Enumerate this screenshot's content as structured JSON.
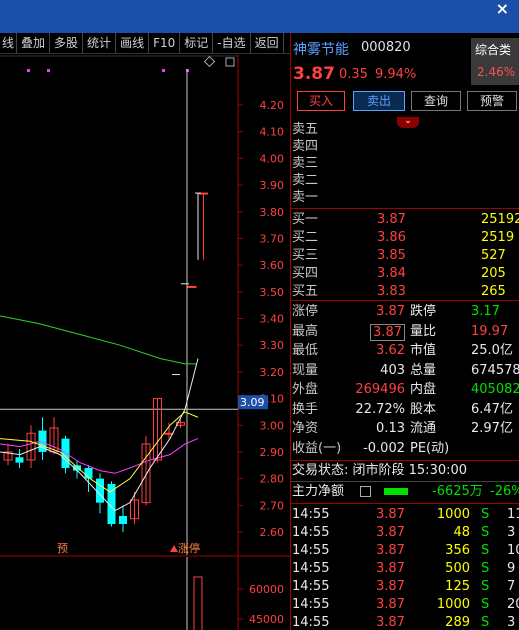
{
  "window": {
    "close_icon": "×"
  },
  "toolbar": [
    "叠加",
    "多股",
    "统计",
    "画线",
    "F10",
    "标记",
    "-自选",
    "返回"
  ],
  "toolbar_lead": "线",
  "stock": {
    "name": "神雾节能",
    "code": "000820",
    "price": "3.87",
    "change": "0.35",
    "change_pct": "9.94%",
    "rank_label": "综合类",
    "rank_value": "2.46%"
  },
  "buttons": {
    "buy": "买入",
    "sell": "卖出",
    "query": "查询",
    "warn": "预警"
  },
  "asks_top": [
    "卖五",
    "卖四",
    "卖三",
    "卖二",
    "卖一"
  ],
  "bids": [
    {
      "label": "买一",
      "price": "3.87",
      "vol": "25192"
    },
    {
      "label": "买二",
      "price": "3.86",
      "vol": "2519"
    },
    {
      "label": "买三",
      "price": "3.85",
      "vol": "527"
    },
    {
      "label": "买四",
      "price": "3.84",
      "vol": "205"
    },
    {
      "label": "买五",
      "price": "3.83",
      "vol": "265"
    }
  ],
  "stats": [
    {
      "l1": "涨停",
      "v1": "3.87",
      "l2": "跌停",
      "v2": "3.17"
    },
    {
      "l1": "最高",
      "v1": "3.87",
      "l2": "量比",
      "v2": "19.97"
    },
    {
      "l1": "最低",
      "v1": "3.62",
      "l2": "市值",
      "v2": "25.0亿"
    },
    {
      "l1": "现量",
      "v1": "403",
      "l2": "总量",
      "v2": "674578"
    },
    {
      "l1": "外盘",
      "v1": "269496",
      "l2": "内盘",
      "v2": "405082"
    },
    {
      "l1": "换手",
      "v1": "22.72%",
      "l2": "股本",
      "v2": "6.47亿"
    },
    {
      "l1": "净资",
      "v1": "0.13",
      "l2": "流通",
      "v2": "2.97亿"
    },
    {
      "l1": "收益(一)",
      "v1": "-0.002",
      "l2": "PE(动)",
      "v2": ""
    }
  ],
  "trade_status": "交易状态: 闭市阶段 15:30:00",
  "main_flow": {
    "label": "主力净额",
    "value": "-6625万",
    "pct": "-26%"
  },
  "ticks": [
    {
      "time": "14:55",
      "price": "3.87",
      "vol": "1000",
      "side": "S",
      "n": "11"
    },
    {
      "time": "14:55",
      "price": "3.87",
      "vol": "48",
      "side": "S",
      "n": "3"
    },
    {
      "time": "14:55",
      "price": "3.87",
      "vol": "356",
      "side": "S",
      "n": "10"
    },
    {
      "time": "14:55",
      "price": "3.87",
      "vol": "500",
      "side": "S",
      "n": "9"
    },
    {
      "time": "14:55",
      "price": "3.87",
      "vol": "125",
      "side": "S",
      "n": "7"
    },
    {
      "time": "14:55",
      "price": "3.87",
      "vol": "1000",
      "side": "S",
      "n": "20"
    },
    {
      "time": "14:55",
      "price": "3.87",
      "vol": "289",
      "side": "S",
      "n": "3"
    }
  ],
  "chart": {
    "y_ticks": [
      "4.20",
      "4.10",
      "4.00",
      "3.90",
      "3.80",
      "3.70",
      "3.60",
      "3.50",
      "3.40",
      "3.30",
      "3.20",
      "3.10",
      "3.00",
      "2.90",
      "2.80",
      "2.70",
      "2.60"
    ],
    "y_range": [
      2.55,
      4.27
    ],
    "cursor_value": "3.09",
    "vol_ticks": [
      "60000",
      "45000"
    ],
    "marker_pre": "预",
    "marker_limit": "涨停",
    "candles": [
      {
        "o": 2.87,
        "c": 2.9,
        "h": 2.93,
        "l": 2.85
      },
      {
        "o": 2.88,
        "c": 2.86,
        "h": 2.91,
        "l": 2.84
      },
      {
        "o": 2.87,
        "c": 2.97,
        "h": 3.0,
        "l": 2.84
      },
      {
        "o": 2.98,
        "c": 2.9,
        "h": 3.03,
        "l": 2.87
      },
      {
        "o": 2.9,
        "c": 2.99,
        "h": 3.03,
        "l": 2.89
      },
      {
        "o": 2.95,
        "c": 2.84,
        "h": 2.96,
        "l": 2.82
      },
      {
        "o": 2.85,
        "c": 2.83,
        "h": 2.87,
        "l": 2.8
      },
      {
        "o": 2.84,
        "c": 2.8,
        "h": 2.85,
        "l": 2.75
      },
      {
        "o": 2.8,
        "c": 2.71,
        "h": 2.82,
        "l": 2.67
      },
      {
        "o": 2.78,
        "c": 2.63,
        "h": 2.79,
        "l": 2.62
      },
      {
        "o": 2.66,
        "c": 2.63,
        "h": 2.7,
        "l": 2.6
      },
      {
        "o": 2.65,
        "c": 2.72,
        "h": 2.75,
        "l": 2.63
      },
      {
        "o": 2.71,
        "c": 2.93,
        "h": 2.96,
        "l": 2.7
      },
      {
        "o": 2.87,
        "c": 3.1,
        "h": 3.1,
        "l": 2.86
      },
      {
        "o": 2.97,
        "c": 2.97,
        "h": 3.01,
        "l": 2.95
      },
      {
        "o": 3.0,
        "c": 3.01,
        "h": 3.03,
        "l": 2.99
      },
      {
        "o": 3.52,
        "c": 3.52,
        "h": 3.52,
        "l": 3.52
      },
      {
        "o": 3.87,
        "c": 3.87,
        "h": 3.87,
        "l": 3.62
      }
    ]
  }
}
